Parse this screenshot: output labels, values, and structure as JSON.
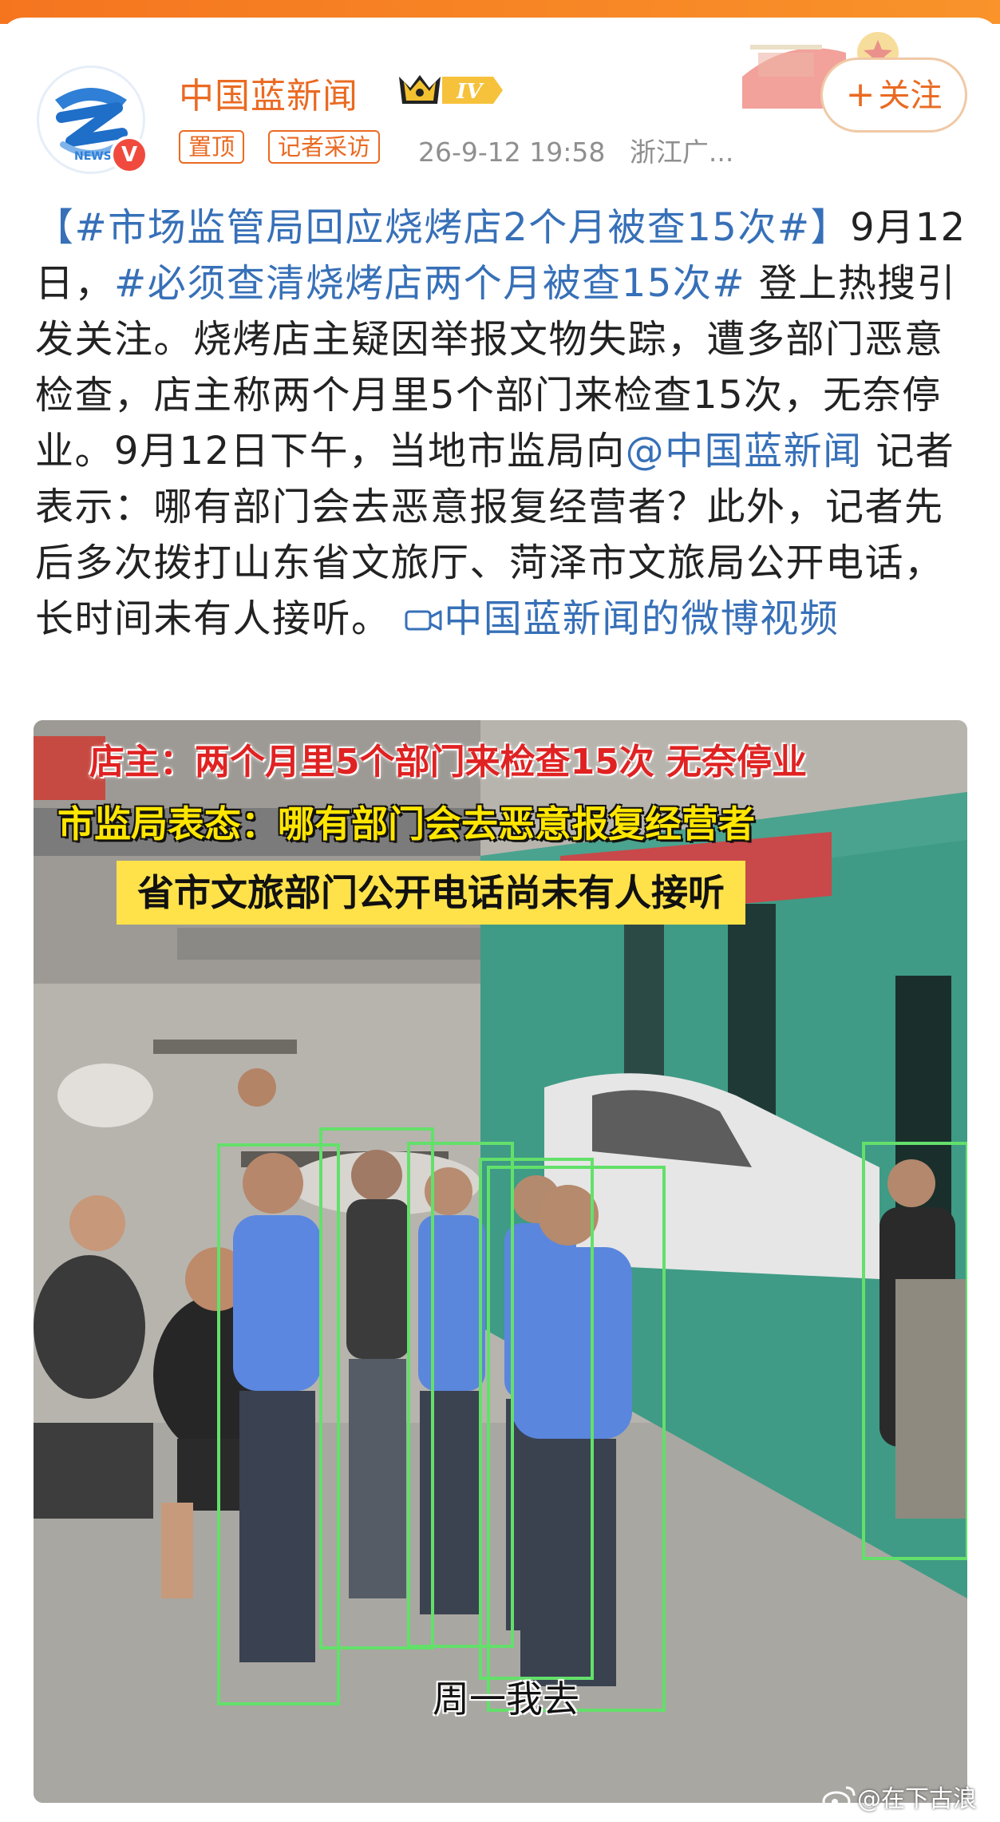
{
  "account": {
    "name": "中国蓝新闻",
    "level": "IV",
    "verified_mark": "V",
    "tags": [
      "置顶",
      "记者采访"
    ],
    "timestamp": "26-9-12 19:58",
    "source": "浙江广...",
    "follow_label": "关注",
    "follow_icon": "plus-icon"
  },
  "post": {
    "hashtag1": "【#市场监管局回应烧烤店2个月被查15次#】",
    "text1": "9月12日，",
    "hashtag2": "#必须查清烧烤店两个月被查15次#",
    "text2": " 登上热搜引发关注。烧烤店主疑因举报文物失踪，遭多部门恶意检查，店主称两个月里5个部门来检查15次，无奈停业。9月12日下午，当地市监局向",
    "mention": "@中国蓝新闻",
    "text3": " 记者表示：哪有部门会去恶意报复经营者？此外，记者先后多次拨打山东省文旅厅、菏泽市文旅局公开电话，长时间未有人接听。",
    "video_link": "中国蓝新闻的微博视频",
    "video_icon": "video-camera-icon"
  },
  "media": {
    "caption_line1": "店主：两个月里5个部门来检查15次 无奈停业",
    "caption_line2": "市监局表态：哪有部门会去恶意报复经营者",
    "caption_line3": "省市文旅部门公开电话尚未有人接听",
    "subtitle": "周一我去",
    "watermark": "@在下古浪"
  },
  "colors": {
    "brand_orange": "#ea6a22",
    "link_blue": "#3770b8",
    "caption_red": "#e02222",
    "caption_yellow": "#ffe600"
  }
}
